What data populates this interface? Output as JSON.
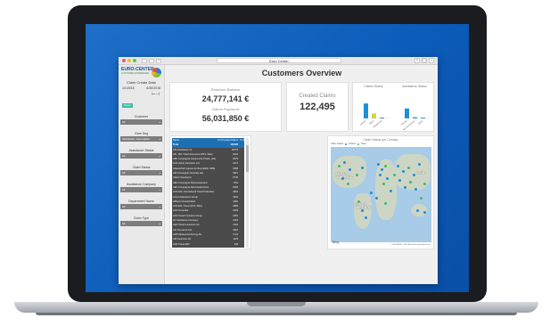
{
  "browser": {
    "url": "Euro Center"
  },
  "sidebar": {
    "logo_text": "EURO-CENTER",
    "logo_sub": "CUSTOMER EXPERIENCE",
    "date_label": "Claim Create Date",
    "date_from": "1/1/2016",
    "date_to": "6/30/2016",
    "reset_label": "Reset",
    "filters": [
      {
        "label": "Customer",
        "value": "All"
      },
      {
        "label": "Gear Seg",
        "value": "Worldwide, Generalists"
      },
      {
        "label": "Assistance Status",
        "value": "All"
      },
      {
        "label": "Claim Status",
        "value": "All"
      },
      {
        "label": "Assistance Company",
        "value": "All"
      },
      {
        "label": "Department Name",
        "value": "All"
      },
      {
        "label": "Claim Type",
        "value": "All"
      }
    ]
  },
  "dashboard": {
    "title": "Customers Overview",
    "reserves_label": "Reserves Balance",
    "reserves_value": "24,777,141 €",
    "payments_label": "Claims Payments",
    "payments_value": "56,031,850 €",
    "created_label": "Created Claims",
    "created_value": "122,495",
    "claim_status_title": "Claims Status",
    "assistance_status_title": "Assistance Status",
    "map_title": "Claim Status per Country",
    "map_legend": [
      "Claim Status",
      "Closed",
      "Open"
    ],
    "map_labels": [
      "NORTH AMERICA",
      "ASIA",
      "SOUTH AMERICA"
    ],
    "bing": "Bing",
    "copyright": "© 2016 HERE © 2016 Microsoft Corporation Terms"
  },
  "table": {
    "headers": [
      "Name",
      "# of Created Claims",
      "% of Created Claims"
    ],
    "rows": [
      [
        "Total",
        "122495",
        "100.00%"
      ],
      [
        "AIG Assistance Int.",
        "25775",
        "21.04%"
      ],
      [
        "AB - SKL Travel Insurance (DTA, SEA)",
        "9232",
        "7.54%"
      ],
      [
        "ABC Compagnie Assurances Privée, (AA)",
        "8379",
        "6.84%"
      ],
      [
        "AGF (AXA) Insurance Ltd.",
        "6472",
        "5.28%"
      ],
      [
        "Allianz/AGF Agence de Reis (EKR, NDS)",
        "5688",
        "4.64%"
      ],
      [
        "AM Compagnie Generale des",
        "5610",
        "4.58%"
      ],
      [
        "Allianz Assistance",
        "5740",
        "4.69%"
      ],
      [
        "AEG Compagnie Reizenassuranc",
        "7511",
        "6.13%"
      ],
      [
        "AEG Compagnie Reizenassurance",
        "5165",
        "4.22%"
      ],
      [
        "AGF-EXL International Travel Protection",
        "4804",
        "3.92%"
      ],
      [
        "AGLA Assistance Group",
        "4432",
        "3.62%"
      ],
      [
        "AllSecur Deutschland",
        "4300",
        "3.51%"
      ],
      [
        "AXA-EXL Travel (DTA, SEA)",
        "2889",
        "2.36%"
      ],
      [
        "AXA Corporate",
        "2329",
        "1.90%"
      ],
      [
        "AXA Travel Insurance Group",
        "2281",
        "1.86%"
      ],
      [
        "AP Assistance Company",
        "2164",
        "1.77%"
      ],
      [
        "AEA Travel Insurance Ltd.",
        "2102",
        "1.72%"
      ],
      [
        "AIC Insurance Ltd.",
        "1804",
        "1.47%"
      ],
      [
        "AFIP Reiseversicherung AG",
        "1734",
        "1.42%"
      ],
      [
        "AM Insurance AG",
        "1125",
        "0.92%"
      ],
      [
        "ADA Travel ABC",
        "918",
        "0.75%"
      ],
      [
        "ADAC Reiseversicherung",
        "857",
        "0.70%"
      ],
      [
        "ADCO Assistance Group Limited",
        "792",
        "0.65%"
      ],
      [
        "AL Care Reiseversicherung",
        "788",
        "0.64%"
      ],
      [
        "AE Insurance Holding",
        "786",
        "0.64%"
      ],
      [
        "ADAC Travel Services Ltd.",
        "761",
        "0.62%"
      ]
    ],
    "total": [
      "Total",
      "122495",
      "100.00%"
    ]
  },
  "chart_data": [
    {
      "type": "bar",
      "title": "Claims Status",
      "categories": [
        "Closed",
        "Open",
        "Reopened"
      ],
      "values": [
        120000,
        40000,
        2000
      ],
      "ylim": [
        0,
        200000
      ]
    },
    {
      "type": "bar",
      "title": "Assistance Status",
      "categories": [
        "Closed",
        "Not Assistance",
        "Open"
      ],
      "values": [
        80000,
        10000,
        3000
      ],
      "ylim": [
        0,
        200000
      ]
    }
  ],
  "colors": {
    "accent": "#1f6fb5",
    "bar_blue": "#1f8fd8",
    "bar_yellow": "#d8d24a",
    "reset": "#3dbba6"
  }
}
